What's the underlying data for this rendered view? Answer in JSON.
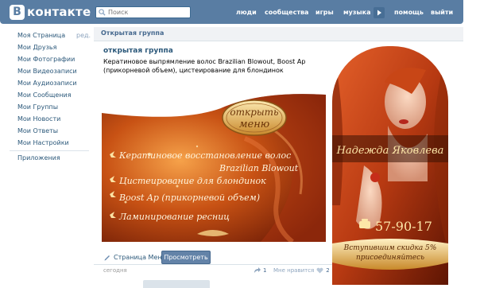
{
  "header": {
    "logo_badge": "В",
    "logo_text": "контакте",
    "search_placeholder": "Поиск",
    "nav": {
      "people": "люди",
      "communities": "сообщества",
      "games": "игры",
      "music": "музыка",
      "help": "помощь",
      "logout": "выйти"
    }
  },
  "left_menu": {
    "items": [
      "Моя Страница",
      "Мои Друзья",
      "Мои Фотографии",
      "Мои Видеозаписи",
      "Мои Аудиозаписи",
      "Мои Сообщения",
      "Мои Группы",
      "Мои Новости",
      "Мои Ответы",
      "Мои Настройки"
    ],
    "edit": "ред.",
    "apps": "Приложения"
  },
  "content": {
    "breadcrumb": "Открытая группа",
    "group_title": "открытая группа",
    "group_desc": "Кератиновое выпрямление волос Brazilian Blowout, Boost Ap (прикорневой объем), цистеирование для блондинок"
  },
  "banner": {
    "badge_line1": "открыть",
    "badge_line2": "меню",
    "lines": [
      "Кератиновое восстановление волос",
      "Brazilian Blowout",
      "Цистеирование для блондинок",
      "Boost Ap (прикорневой объем)",
      "Ламинирование ресниц"
    ]
  },
  "portrait": {
    "name": "Надежда Яковлева",
    "phone": "57-90-17",
    "promo_line1": "Вступившим скидка 5%",
    "promo_line2": "присоединяйтесь"
  },
  "post": {
    "menu_link": "Страница Меню",
    "view_button": "Просмотреть",
    "date": "сегодня",
    "share_count": "1",
    "like_label": "Мне нравится",
    "like_count": "2"
  },
  "colors": {
    "header_blue": "#597da3",
    "link_blue": "#2b587a",
    "button_blue": "#6383a8",
    "banner_gold": "#f3c36b",
    "hair_red": "#b83a12"
  }
}
